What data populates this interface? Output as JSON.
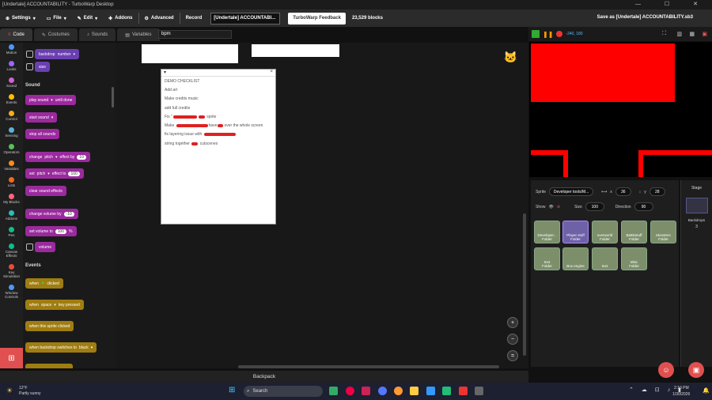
{
  "window": {
    "title": "[Undertale] ACCOUNTABILITY - TurboWarp Desktop",
    "controls": "— ☐ ✕"
  },
  "menu": {
    "settings": "Settings",
    "file": "File",
    "edit": "Edit",
    "addons": "Addons",
    "advanced": "Advanced",
    "record": "Record",
    "project_title": "[Undertale] ACCOUNTABI...",
    "feedback": "TurboWarp Feedback",
    "blocks": "23,529 blocks",
    "save": "Save as [Undertale] ACCOUNTABILITY.sb3"
  },
  "tabs": {
    "code": "Code",
    "costumes": "Costumes",
    "sounds": "Sounds",
    "variables": "Variables"
  },
  "search": {
    "value": "bpm"
  },
  "categories": [
    {
      "label": "Motion",
      "color": "#4c97ff"
    },
    {
      "label": "Looks",
      "color": "#9966ff"
    },
    {
      "label": "Sound",
      "color": "#cf63cf"
    },
    {
      "label": "Events",
      "color": "#ffbf00"
    },
    {
      "label": "Control",
      "color": "#ffab19"
    },
    {
      "label": "Sensing",
      "color": "#5cb1d6"
    },
    {
      "label": "Operators",
      "color": "#59c059"
    },
    {
      "label": "Variables",
      "color": "#ff8c1a"
    },
    {
      "label": "Lists",
      "color": "#ff661a"
    },
    {
      "label": "My Blocks",
      "color": "#ff6680"
    },
    {
      "label": "Addons",
      "color": "#29beb8"
    },
    {
      "label": "Pen",
      "color": "#0fbd8c"
    },
    {
      "label": "Canvas Effects",
      "color": "#0fbd8c"
    },
    {
      "label": "Key Simulation",
      "color": "#e64c3c"
    },
    {
      "label": "Window Controls",
      "color": "#4c97ff"
    }
  ],
  "palette": {
    "backdrop": "backdrop",
    "number": "number",
    "size": "size",
    "sound_header": "Sound",
    "play_sound": "play sound",
    "until_done": "until done",
    "start_sound": "start sound",
    "stop_all": "stop all sounds",
    "change": "change",
    "pitch": "pitch",
    "effect_by": "effect by",
    "ten": "10",
    "set": "set",
    "effect_to": "effect to",
    "clear_effects": "clear sound effects",
    "change_volume": "change volume by",
    "neg_ten": "-10",
    "set_volume": "set volume to",
    "hundred": "100",
    "percent": "%",
    "volume": "volume",
    "events_header": "Events",
    "when": "when",
    "clicked": "clicked",
    "when_key": "when",
    "space": "space",
    "key_pressed": "key pressed",
    "sprite_clicked": "when this sprite clicked",
    "backdrop_switches": "when backdrop switches to",
    "black": "black"
  },
  "checklist": {
    "title": "DEMO CHECKLIST",
    "items": [
      "Add art",
      "Make credits music",
      "add full credits",
      "Fix \"",
      "Make",
      "fix layering issue with",
      "string together"
    ],
    "item4_suffix": "sprite",
    "item5_mid": "have",
    "item5_suffix": "over the whole screen",
    "item7_suffix": "cutscenes",
    "close": "×"
  },
  "backpack": "Backpack",
  "stage": {
    "coords": "-240, 180"
  },
  "sprite_info": {
    "sprite_label": "Sprite",
    "sprite_name": "Developer tools/M...",
    "x_label": "x",
    "x": "36",
    "y_label": "y",
    "y": "28",
    "show_label": "Show",
    "size_label": "Size",
    "size": "100",
    "direction_label": "Direction",
    "direction": "90"
  },
  "sprites": [
    {
      "name": "Developer...",
      "sub": "Folder"
    },
    {
      "name": "Player stuff",
      "sub": "Folder"
    },
    {
      "name": "overworld",
      "sub": "Folder"
    },
    {
      "name": "Battlestuff",
      "sub": "Folder"
    },
    {
      "name": "Monsters",
      "sub": "Folder"
    },
    {
      "name": "text",
      "sub": "Folder"
    },
    {
      "name": "Box engine",
      "sub": ""
    },
    {
      "name": "text",
      "sub": ""
    },
    {
      "name": "Misc",
      "sub": "Folder"
    }
  ],
  "stage_panel": {
    "label": "Stage",
    "backdrops_label": "Backdrops",
    "backdrops": "3"
  },
  "taskbar": {
    "temp": "12°F",
    "weather": "Partly sunny",
    "search": "Search",
    "time": "2:10 PM",
    "date": "1/30/2026"
  }
}
